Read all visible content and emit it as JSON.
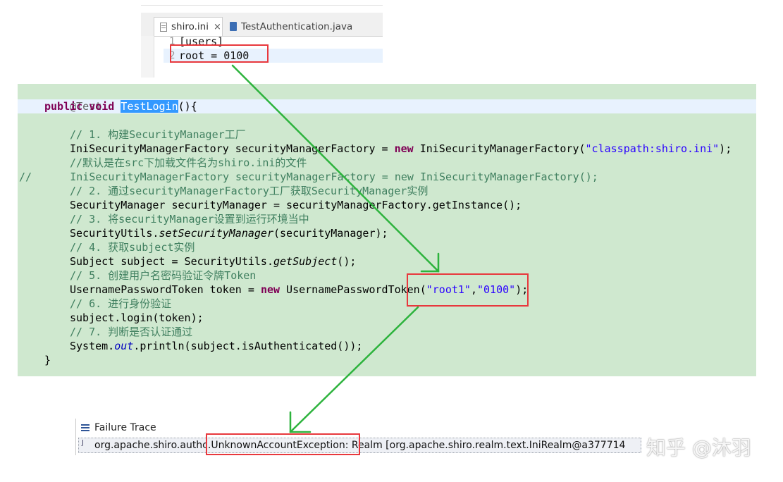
{
  "ini_editor": {
    "tabs": [
      {
        "label": "shiro.ini",
        "close": "×"
      },
      {
        "label": "TestAuthentication.java"
      }
    ],
    "lines": [
      {
        "no": "1",
        "text": "[users]"
      },
      {
        "no": "2",
        "text": "root = 0100"
      }
    ]
  },
  "code": {
    "annotation": "@Test",
    "sig_public": "public",
    "sig_void": "void",
    "method_name": "TestLogin",
    "sig_rest": "(){",
    "c1": "// 1. 构建SecurityManager工厂",
    "l1_a": "IniSecurityManagerFactory securityManagerFactory = ",
    "l1_new": "new",
    "l1_b": " IniSecurityManagerFactory(",
    "l1_str": "\"classpath:shiro.ini\"",
    "l1_c": ");",
    "c2": "//默认是在src下加载文件名为shiro.ini的文件",
    "c3": "//      IniSecurityManagerFactory securityManagerFactory = new IniSecurityManagerFactory();",
    "c4": "// 2. 通过securityManagerFactory工厂获取SecurityManager实例",
    "l2": "SecurityManager securityManager = securityManagerFactory.getInstance();",
    "c5": "// 3. 将securityManager设置到运行环境当中",
    "l3_a": "SecurityUtils.",
    "l3_m": "setSecurityManager",
    "l3_b": "(securityManager);",
    "c6": "// 4. 获取subject实例",
    "l4_a": "Subject subject = SecurityUtils.",
    "l4_m": "getSubject",
    "l4_b": "();",
    "c7": "// 5. 创建用户名密码验证令牌Token",
    "l5_a": "UsernamePasswordToken token = ",
    "l5_new": "new",
    "l5_b": " UsernamePasswordToken(",
    "l5_s1": "\"root1\"",
    "l5_comma": ",",
    "l5_s2": "\"0100\"",
    "l5_c": ");",
    "c8": "// 6. 进行身份验证",
    "l6": "subject.login(token);",
    "c9": "// 7. 判断是否认证通过",
    "l7_a": "System.",
    "l7_f": "out",
    "l7_b": ".println(subject.isAuthenticated());",
    "close": "}"
  },
  "failure_trace": {
    "title": "Failure Trace",
    "text": "org.apache.shiro.authc.UnknownAccountException: Realm [org.apache.shiro.realm.text.IniRealm@a377714"
  },
  "watermark": "知乎 @沐羽",
  "colors": {
    "code_background": "#cfe8cf",
    "highlight_box": "#e8383d",
    "arrow": "#2db33d",
    "keyword": "#7f0055",
    "comment": "#3f7f5f",
    "string": "#2a00ff"
  }
}
